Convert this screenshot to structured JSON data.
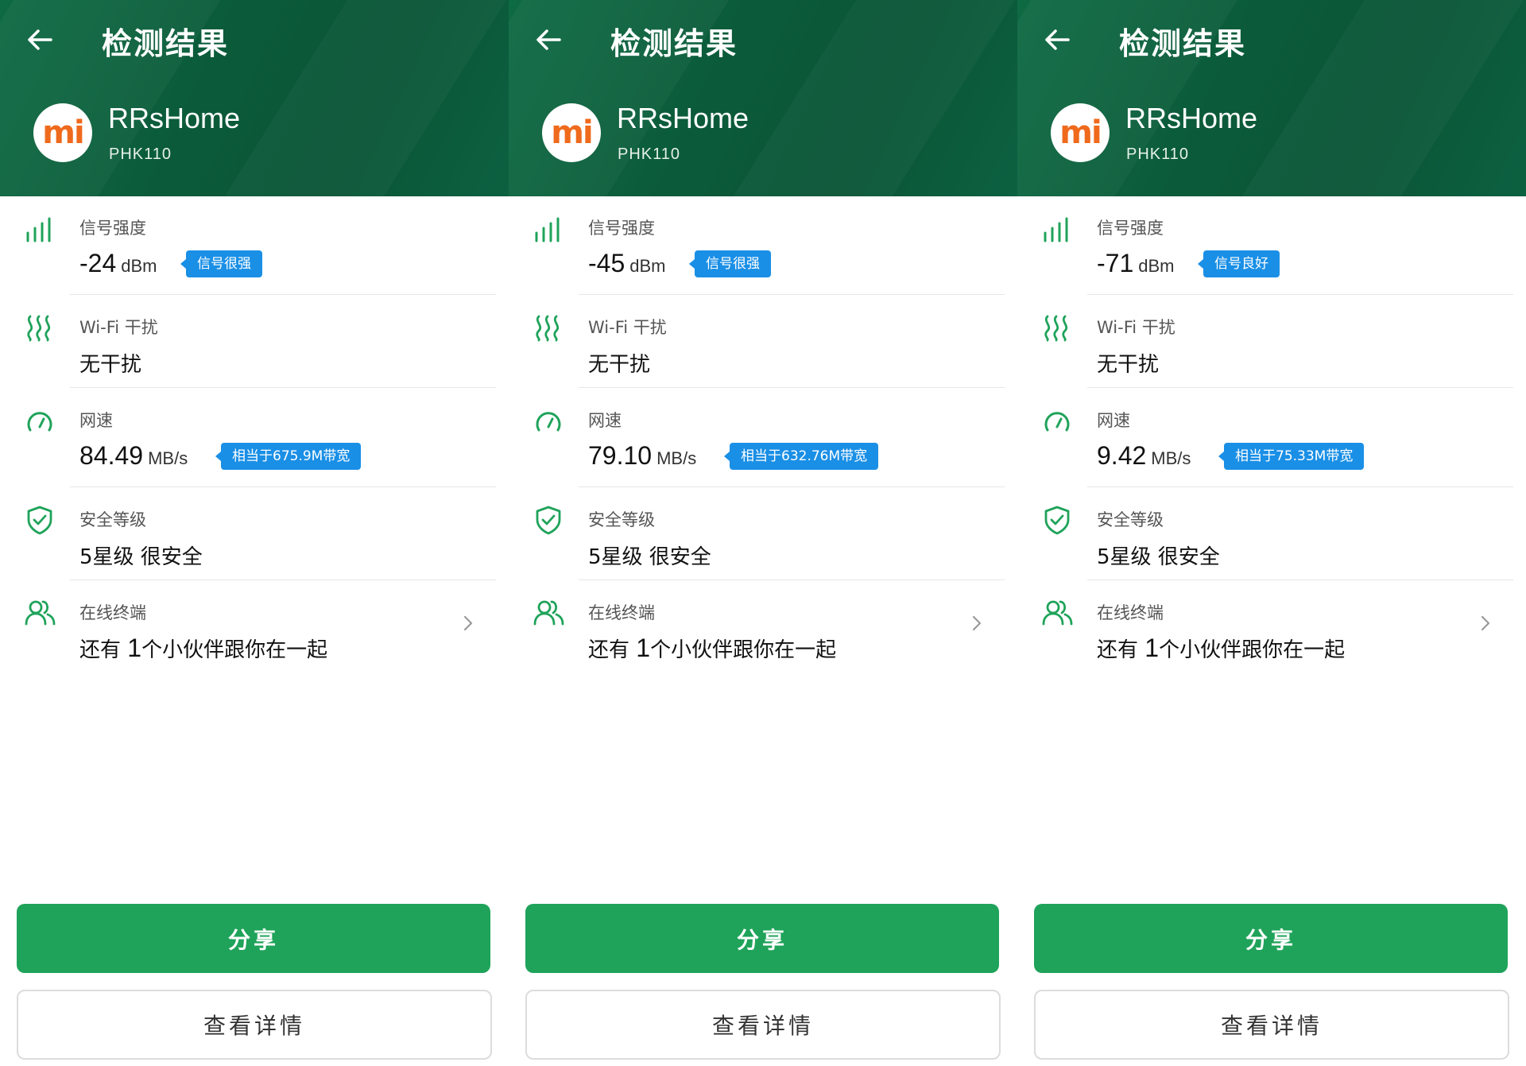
{
  "panels": [
    {
      "title": "检测结果",
      "device": {
        "name": "RRsHome",
        "model": "PHK110",
        "logo_text": "mi"
      },
      "signal": {
        "label": "信号强度",
        "value": "-24",
        "unit": "dBm",
        "badge": "信号很强"
      },
      "interference": {
        "label": "Wi-Fi 干扰",
        "value": "无干扰"
      },
      "speed": {
        "label": "网速",
        "value": "84.49",
        "unit": "MB/s",
        "badge": "相当于675.9M带宽"
      },
      "security": {
        "label": "安全等级",
        "value": "5星级 很安全"
      },
      "terminals": {
        "label": "在线终端",
        "prefix": "还有",
        "count": "1",
        "suffix": "个小伙伴跟你在一起"
      },
      "share_label": "分享",
      "detail_label": "查看详情"
    },
    {
      "title": "检测结果",
      "device": {
        "name": "RRsHome",
        "model": "PHK110",
        "logo_text": "mi"
      },
      "signal": {
        "label": "信号强度",
        "value": "-45",
        "unit": "dBm",
        "badge": "信号很强"
      },
      "interference": {
        "label": "Wi-Fi 干扰",
        "value": "无干扰"
      },
      "speed": {
        "label": "网速",
        "value": "79.10",
        "unit": "MB/s",
        "badge": "相当于632.76M带宽"
      },
      "security": {
        "label": "安全等级",
        "value": "5星级 很安全"
      },
      "terminals": {
        "label": "在线终端",
        "prefix": "还有",
        "count": "1",
        "suffix": "个小伙伴跟你在一起"
      },
      "share_label": "分享",
      "detail_label": "查看详情"
    },
    {
      "title": "检测结果",
      "device": {
        "name": "RRsHome",
        "model": "PHK110",
        "logo_text": "mi"
      },
      "signal": {
        "label": "信号强度",
        "value": "-71",
        "unit": "dBm",
        "badge": "信号良好"
      },
      "interference": {
        "label": "Wi-Fi 干扰",
        "value": "无干扰"
      },
      "speed": {
        "label": "网速",
        "value": "9.42",
        "unit": "MB/s",
        "badge": "相当于75.33M带宽"
      },
      "security": {
        "label": "安全等级",
        "value": "5星级 很安全"
      },
      "terminals": {
        "label": "在线终端",
        "prefix": "还有",
        "count": "1",
        "suffix": "个小伙伴跟你在一起"
      },
      "share_label": "分享",
      "detail_label": "查看详情"
    }
  ],
  "colors": {
    "header_green": "#0b5b3a",
    "icon_green": "#1fa35a",
    "badge_blue": "#1a8fe6",
    "share_button": "#1fa35a",
    "logo_orange": "#ef6a1c"
  },
  "icons": {
    "back": "arrow-left-icon",
    "signal": "signal-bars-icon",
    "interference": "wifi-interference-icon",
    "speed": "speedometer-icon",
    "security": "shield-check-icon",
    "terminals": "users-icon",
    "chevron": "chevron-right-icon"
  }
}
